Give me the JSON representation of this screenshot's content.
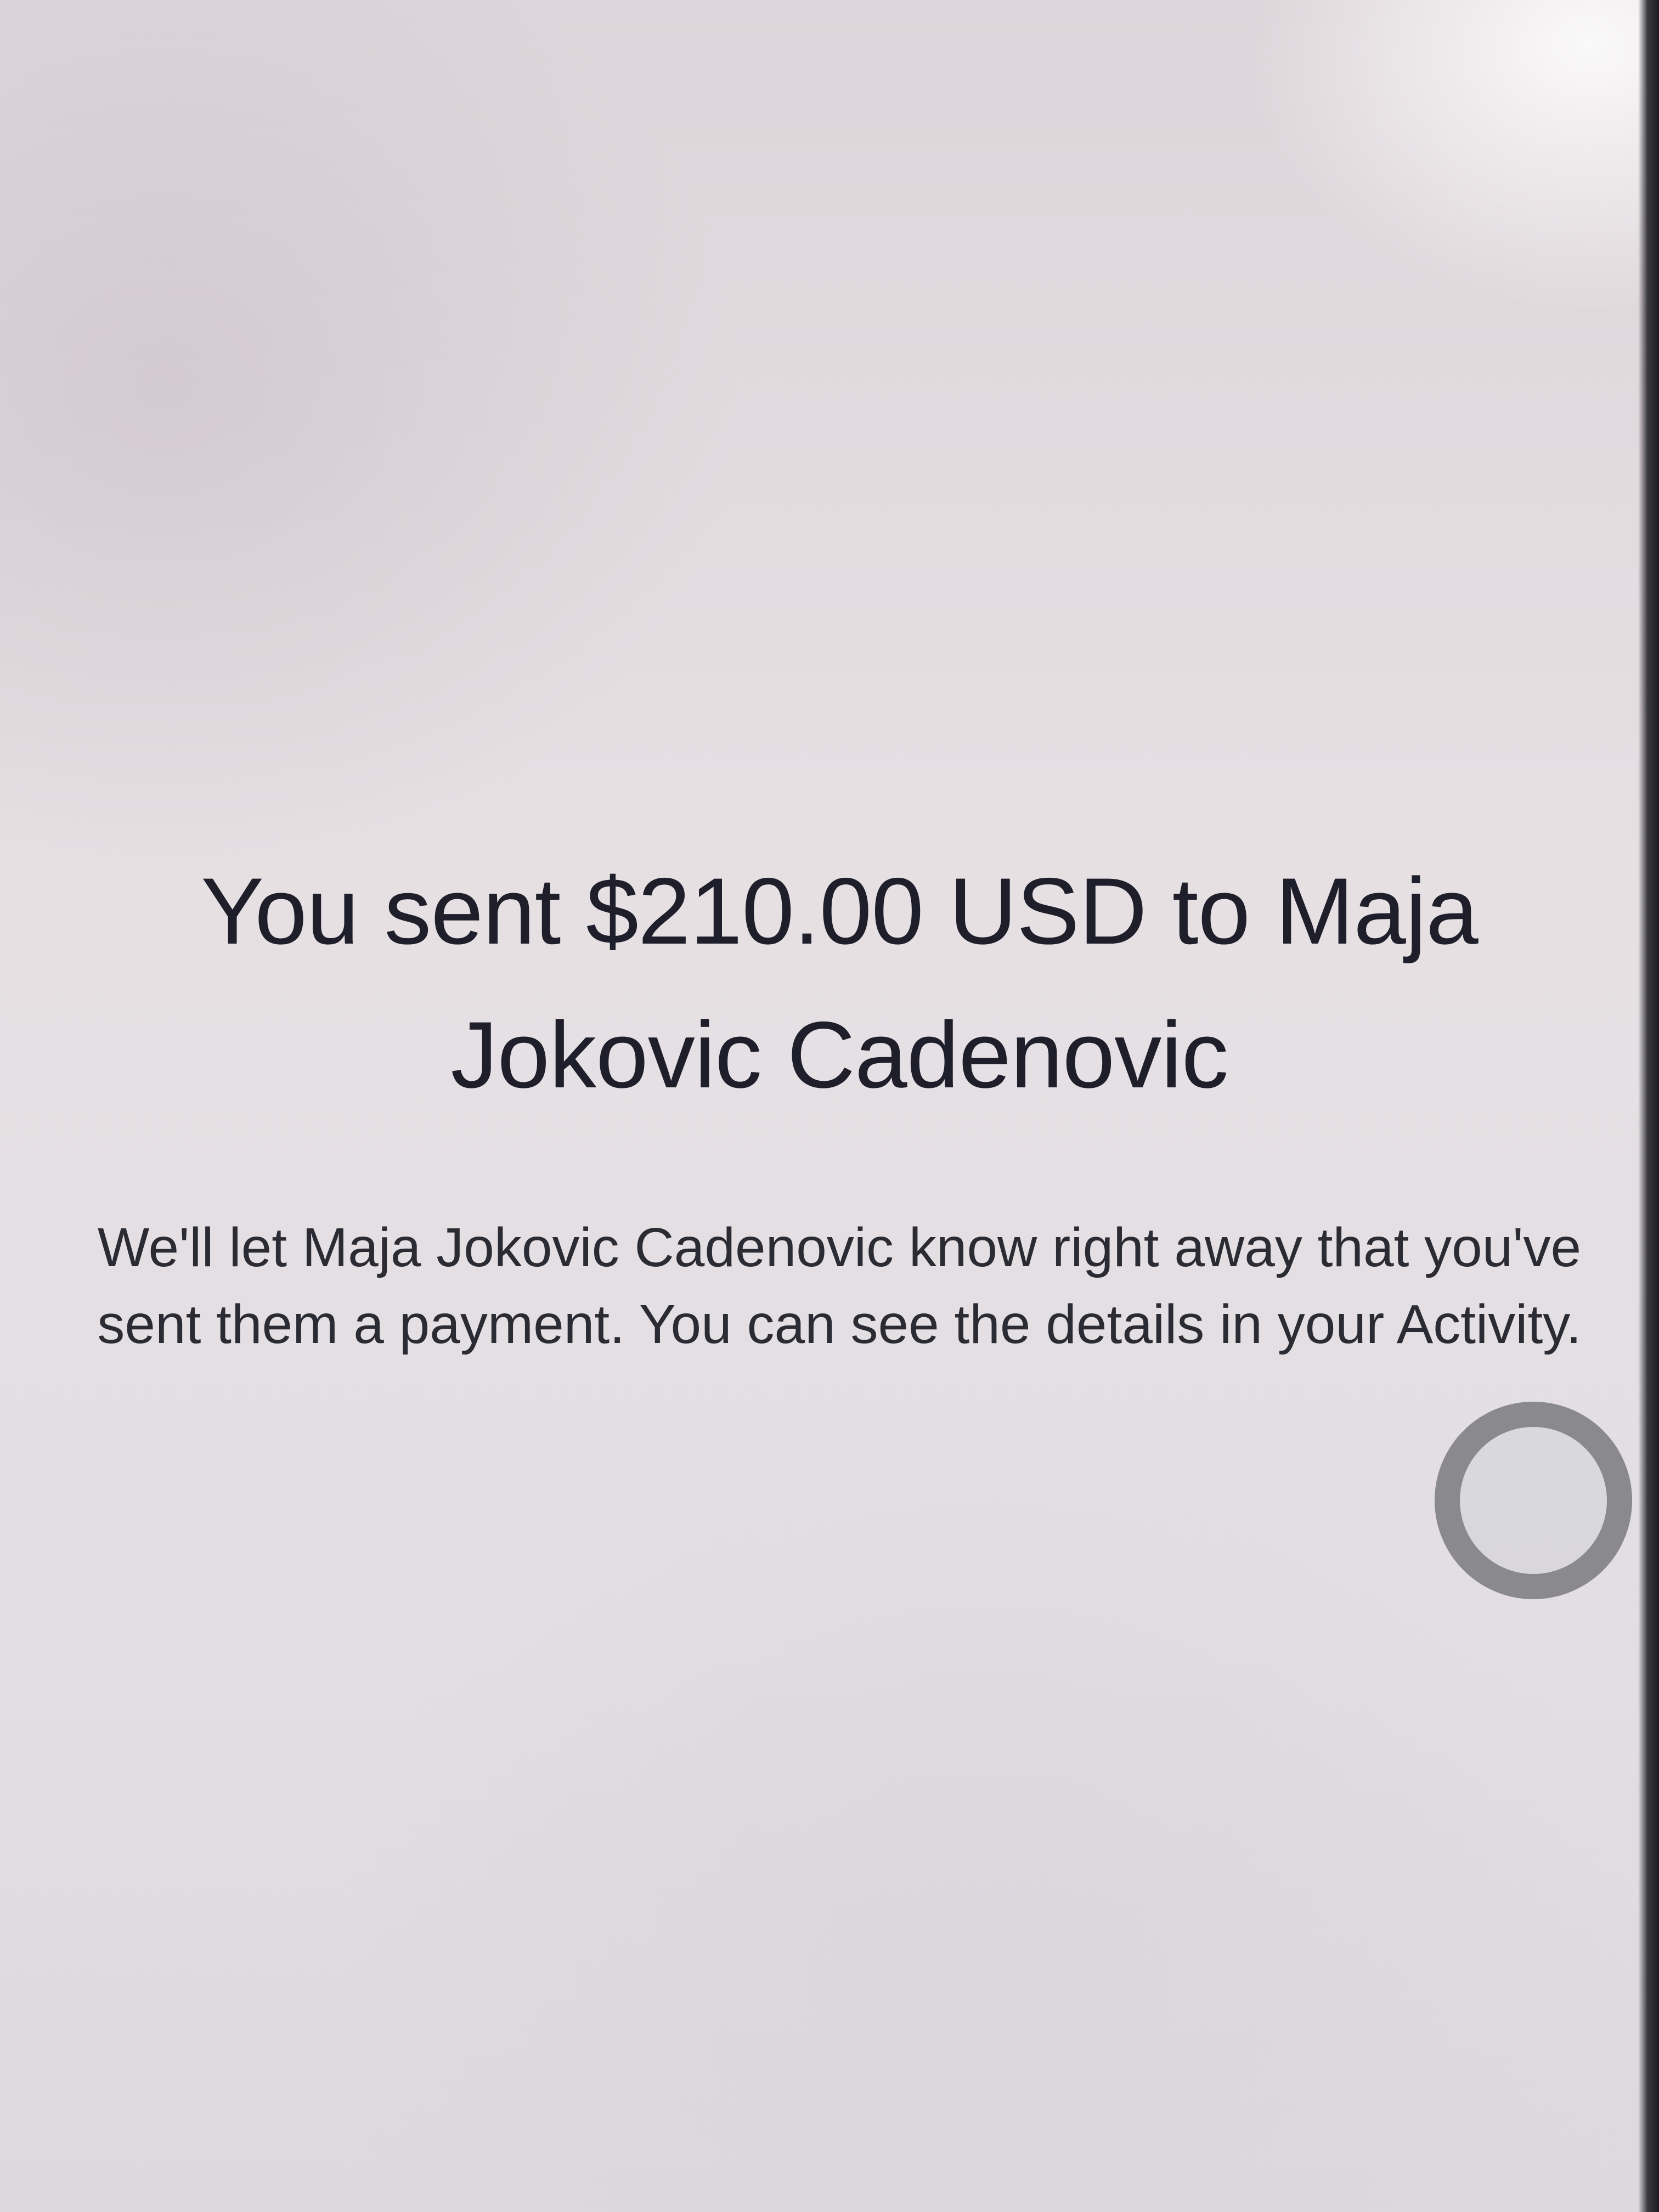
{
  "confirmation": {
    "headline": "You sent $210.00 USD to Maja Jokovic Cadenovic",
    "message": "We'll let Maja Jokovic Cadenovic know right away that you've sent them a payment. You can see the details in your Activity."
  },
  "overlay": {
    "assistive_touch_icon": "assistive-touch-icon"
  },
  "colors": {
    "background": "#e6e1e3",
    "headline_text": "#1f1f2b",
    "body_text": "#2b2b33",
    "assistive_touch_ring": "#8a8a8c"
  }
}
